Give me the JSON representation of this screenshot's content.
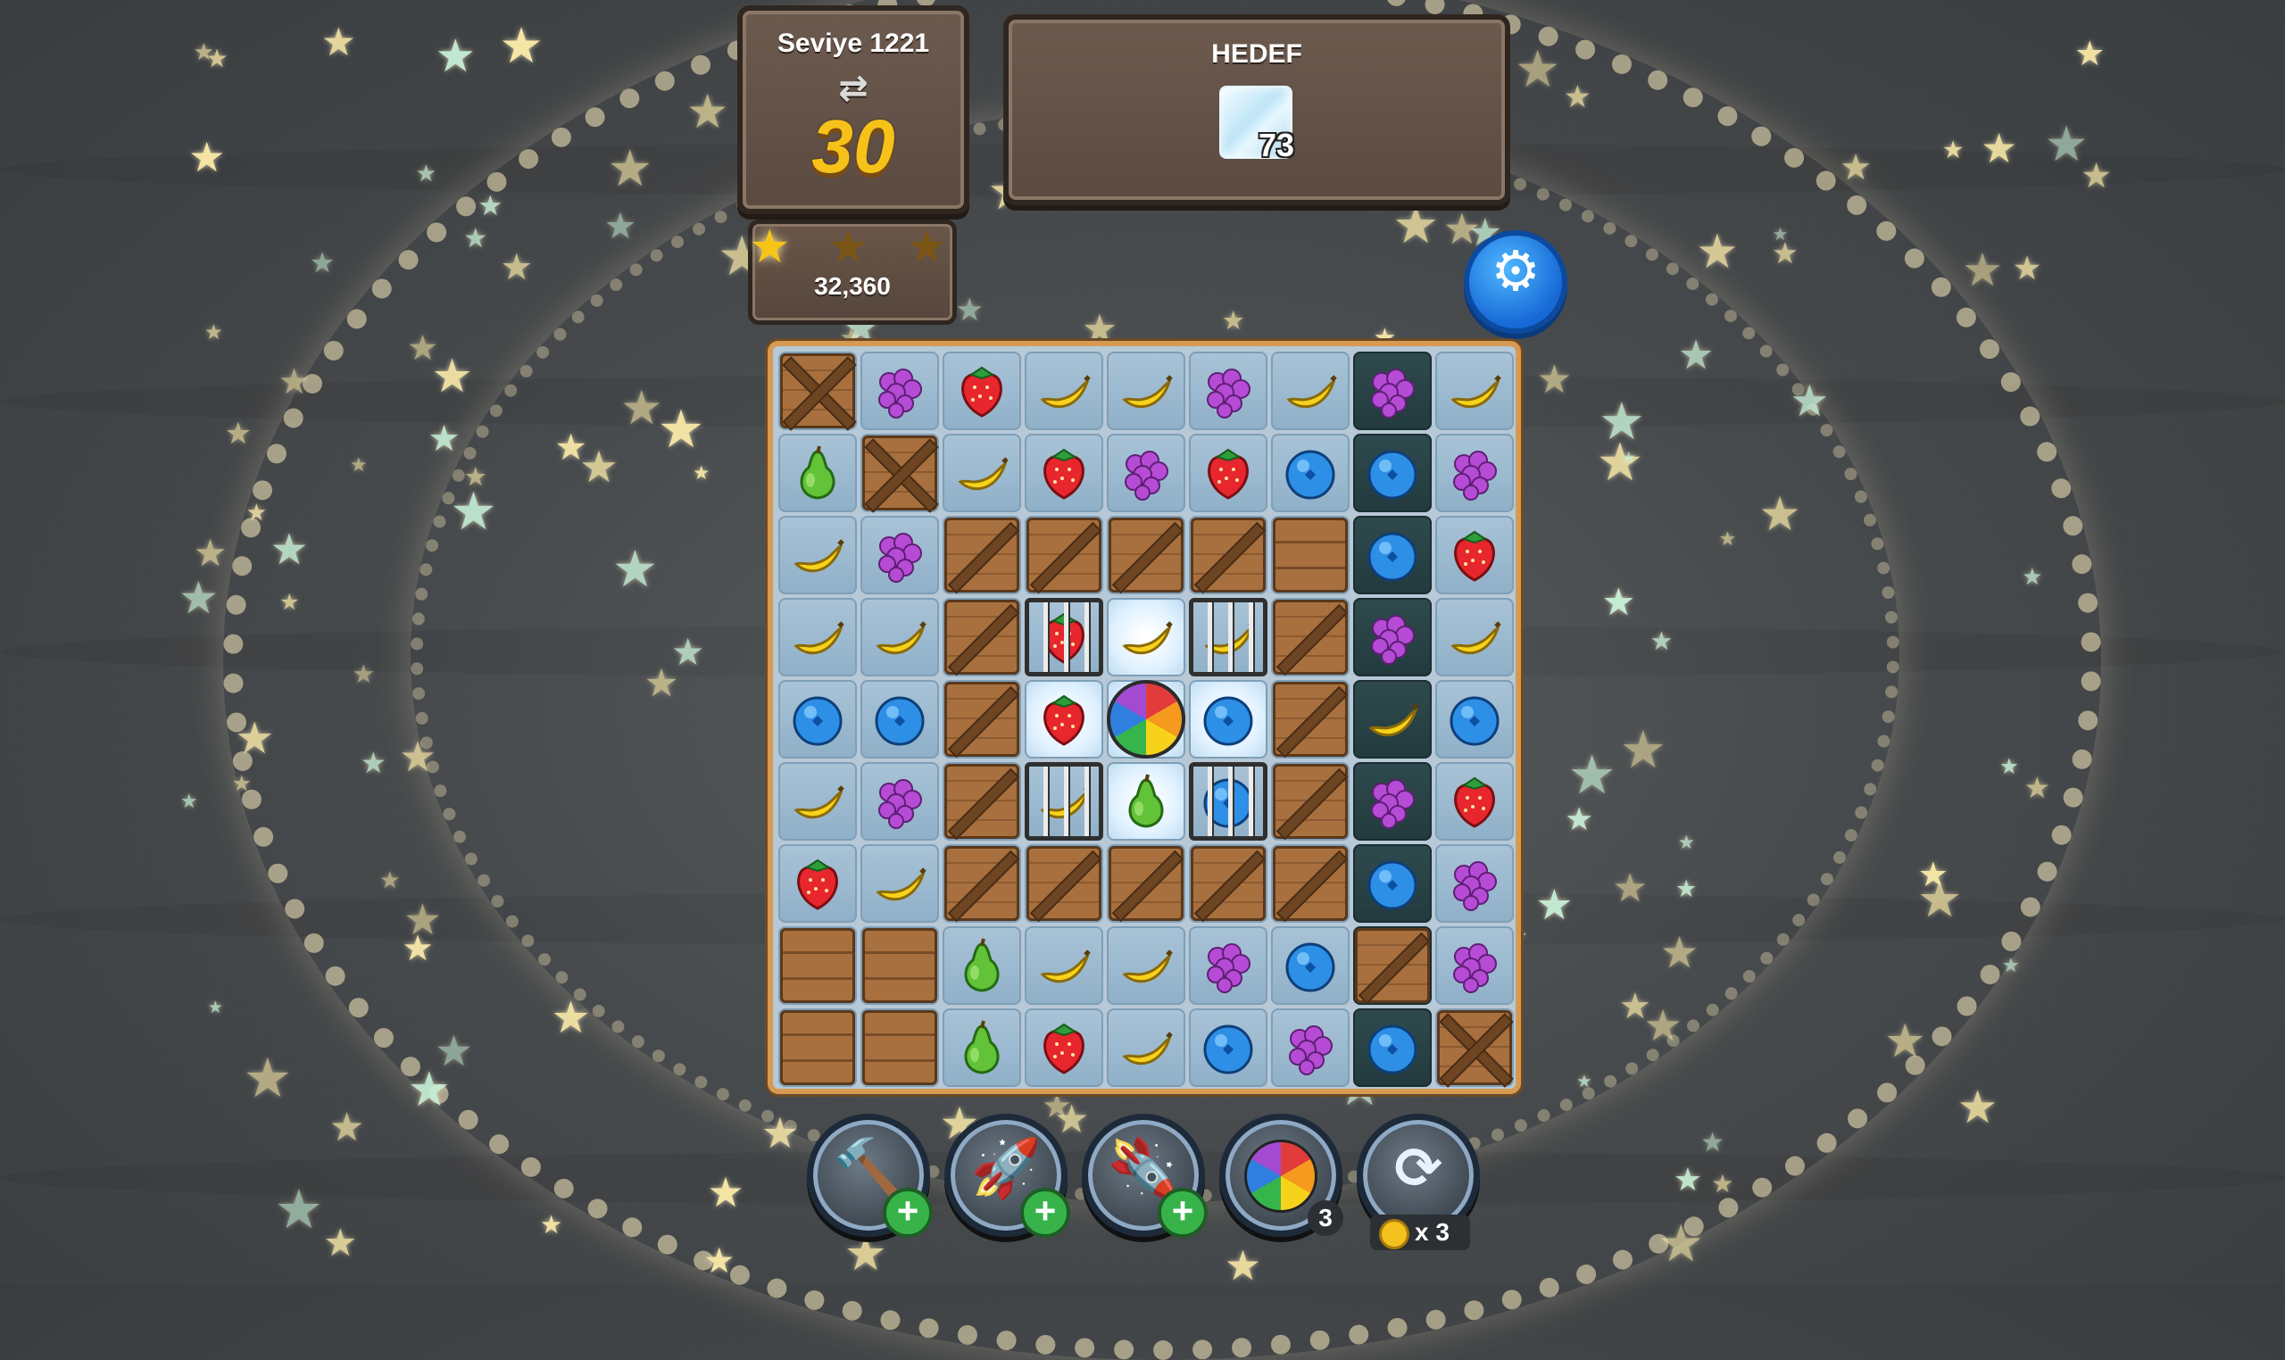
{
  "level": {
    "label": "Seviye 1221",
    "moves": "30"
  },
  "goal": {
    "title": "HEDEF",
    "count": "73",
    "icon": "ice-block-icon"
  },
  "score": {
    "value": "32,360",
    "stars_earned": 1,
    "stars_total": 3
  },
  "settings": {
    "icon": "gear-icon"
  },
  "board": {
    "rows": [
      [
        "crate-x",
        "grape",
        "strawberry",
        "banana",
        "banana",
        "grape",
        "banana",
        "grape",
        "banana"
      ],
      [
        "pear",
        "crate-x",
        "banana",
        "strawberry",
        "grape",
        "strawberry",
        "blueberry",
        "blueberry",
        "grape"
      ],
      [
        "banana",
        "grape",
        "crate-d",
        "crate-d",
        "crate-d",
        "crate-d",
        "crate-h",
        "blueberry",
        "strawberry"
      ],
      [
        "banana",
        "banana",
        "crate-d",
        "strawberry-caged",
        "banana",
        "banana-caged",
        "crate-d",
        "grape",
        "banana"
      ],
      [
        "blueberry",
        "blueberry",
        "crate-d",
        "strawberry",
        "rainbow-bomb",
        "blueberry",
        "crate-d",
        "banana",
        "blueberry"
      ],
      [
        "banana",
        "grape",
        "crate-d",
        "banana-caged",
        "pear",
        "blueberry-caged",
        "crate-d",
        "grape",
        "strawberry"
      ],
      [
        "strawberry",
        "banana",
        "crate-d",
        "crate-d",
        "crate-d",
        "crate-d",
        "crate-d",
        "blueberry",
        "grape"
      ],
      [
        "crate-h",
        "crate-h",
        "pear",
        "banana",
        "banana",
        "grape",
        "blueberry",
        "crate-d",
        "grape"
      ],
      [
        "crate-h",
        "crate-h",
        "pear",
        "strawberry",
        "banana",
        "blueberry",
        "grape",
        "blueberry",
        "crate-x"
      ]
    ],
    "dark_column": 7,
    "glow_cells": [
      "3-4",
      "4-3",
      "4-4",
      "4-5",
      "5-4"
    ]
  },
  "boosters": [
    {
      "name": "hammer",
      "icon": "hammer-icon",
      "badge": "+"
    },
    {
      "name": "rocket-vertical",
      "icon": "rocket-icon",
      "badge": "+"
    },
    {
      "name": "rocket-horizontal",
      "icon": "rocket-horizontal-icon",
      "badge": "+"
    },
    {
      "name": "rainbow-bomb",
      "icon": "rainbow-bomb-icon",
      "count": "3"
    },
    {
      "name": "shuffle",
      "icon": "shuffle-icon",
      "cost": "x 3"
    }
  ],
  "colors": {
    "panel": "#5f4d43",
    "board_border": "#d79a52",
    "moves": "#f6c21a",
    "settings": "#1f7fe6"
  }
}
